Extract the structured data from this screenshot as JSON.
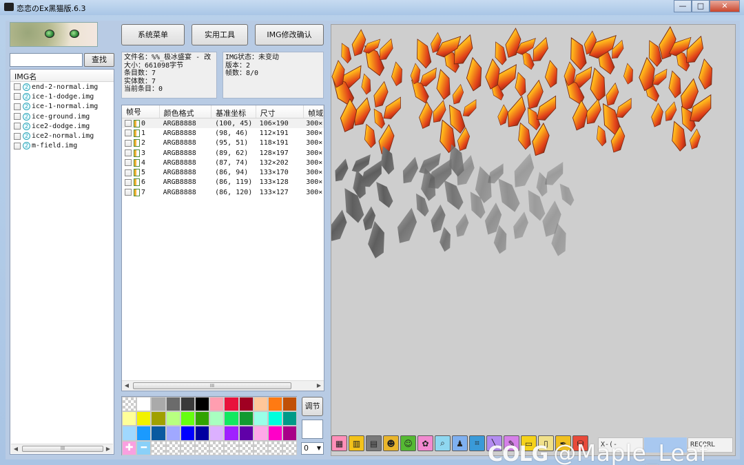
{
  "window": {
    "title": "恋恋のEx黑猫版.6.3",
    "minimize_glyph": "—",
    "maximize_glyph": "□",
    "close_glyph": "✕"
  },
  "left_panel": {
    "search_value": "",
    "search_button": "查找",
    "list_header": "IMG名",
    "img_files": [
      "end-2-normal.img",
      "ice-1-dodge.img",
      "ice-1-normal.img",
      "ice-ground.img",
      "ice2-dodge.img",
      "ice2-normal.img",
      "m-field.img"
    ],
    "icon_glyph": "2",
    "scroll_left": "◀",
    "scroll_right": "▶",
    "scroll_thumb": "III"
  },
  "toolbar_top": {
    "system_menu": "系统菜单",
    "tools": "实用工具",
    "img_confirm": "IMG修改确认"
  },
  "file_info": {
    "lines": [
      "文件名：%%_极冰盛宴 - 改",
      "大小：661098字节",
      "条目数：7",
      "实体数：7",
      "当前条目：0"
    ]
  },
  "img_status": {
    "lines": [
      "IMG状态：未变动",
      "版本：2",
      "帧数：8/0"
    ]
  },
  "frame_table": {
    "columns": [
      "帧号",
      "颜色格式",
      "基准坐标",
      "尺寸",
      "帧域"
    ],
    "rows": [
      {
        "index": "0",
        "format": "ARGB8888",
        "base": "(100, 45)",
        "size": "106×190",
        "domain": "300×"
      },
      {
        "index": "1",
        "format": "ARGB8888",
        "base": "(98, 46)",
        "size": "112×191",
        "domain": "300×"
      },
      {
        "index": "2",
        "format": "ARGB8888",
        "base": "(95, 51)",
        "size": "118×191",
        "domain": "300×"
      },
      {
        "index": "3",
        "format": "ARGB8888",
        "base": "(89, 62)",
        "size": "128×197",
        "domain": "300×"
      },
      {
        "index": "4",
        "format": "ARGB8888",
        "base": "(87, 74)",
        "size": "132×202",
        "domain": "300×"
      },
      {
        "index": "5",
        "format": "ARGB8888",
        "base": "(86, 94)",
        "size": "133×170",
        "domain": "300×"
      },
      {
        "index": "6",
        "format": "ARGB8888",
        "base": "(86, 119)",
        "size": "133×128",
        "domain": "300×"
      },
      {
        "index": "7",
        "format": "ARGB8888",
        "base": "(86, 120)",
        "size": "133×127",
        "domain": "300×"
      }
    ],
    "scroll_thumb": "III"
  },
  "palette": {
    "colors": [
      "check",
      "#ffffff",
      "#aaaaaa",
      "#6b6b6b",
      "#3a3a3a",
      "#000000",
      "#ff9eb0",
      "#e8123c",
      "#a00022",
      "#ffc79a",
      "#ff7a12",
      "#c05008",
      "#ffff99",
      "#f2f200",
      "#a0a000",
      "#b8ff80",
      "#66ff11",
      "#33a300",
      "#a8ffc0",
      "#12e860",
      "#129a30",
      "#99ffe8",
      "#00ffdd",
      "#009a88",
      "#a0d8ff",
      "#1a9aff",
      "#0a5aa0",
      "#a0a8ff",
      "#0000ff",
      "#0000a0",
      "#dcb0ff",
      "#a020ff",
      "#6000a8",
      "#ffa8e8",
      "#ff00c8",
      "#a80088",
      "plus",
      "minus",
      "check",
      "check",
      "check",
      "check",
      "check",
      "check",
      "check",
      "check",
      "check",
      "check"
    ],
    "plus_glyph": "✚",
    "minus_glyph": "━",
    "adjust_button": "调节",
    "index_value": "0",
    "index_arrow": "▼"
  },
  "canvas": {
    "background": "#cecece"
  },
  "tools": [
    {
      "name": "canvas-tool-icon",
      "glyph": "▦",
      "color": "#ff8fb8"
    },
    {
      "name": "palette-tool-icon",
      "glyph": "▥",
      "color": "#f3c21a"
    },
    {
      "name": "film-tool-icon",
      "glyph": "▤",
      "color": "#7a7a7a"
    },
    {
      "name": "cat-tool-icon",
      "glyph": "☻",
      "color": "#e9b52c"
    },
    {
      "name": "frog-tool-icon",
      "glyph": "☺",
      "color": "#55b933"
    },
    {
      "name": "ghost-tool-icon",
      "glyph": "✿",
      "color": "#f28ad0"
    },
    {
      "name": "magnifier-icon",
      "glyph": "⌕",
      "color": "#8fd7f0"
    },
    {
      "name": "boot-tool-icon",
      "glyph": "♟",
      "color": "#7fb0f0"
    },
    {
      "name": "crop-icon",
      "glyph": "⌗",
      "color": "#3a9ad8"
    },
    {
      "name": "line-tool-icon",
      "glyph": "╲",
      "color": "#b38cf0"
    },
    {
      "name": "pen-tool-icon",
      "glyph": "✎",
      "color": "#d580e8"
    },
    {
      "name": "folder-tool-icon",
      "glyph": "▭",
      "color": "#f5d21a"
    },
    {
      "name": "doc-tool-icon",
      "glyph": "▯",
      "color": "#f0e08a"
    },
    {
      "name": "eyedropper-icon",
      "glyph": "✒",
      "color": "#f0c020"
    },
    {
      "name": "bucket-icon",
      "glyph": "⛁",
      "color": "#e84a3a"
    }
  ],
  "coords": {
    "x_label": "X-(-",
    "y_label": "",
    "zoom_label": "RECORL"
  },
  "watermark": {
    "logo": "COLG",
    "handle": "@Maple_Leaf"
  }
}
